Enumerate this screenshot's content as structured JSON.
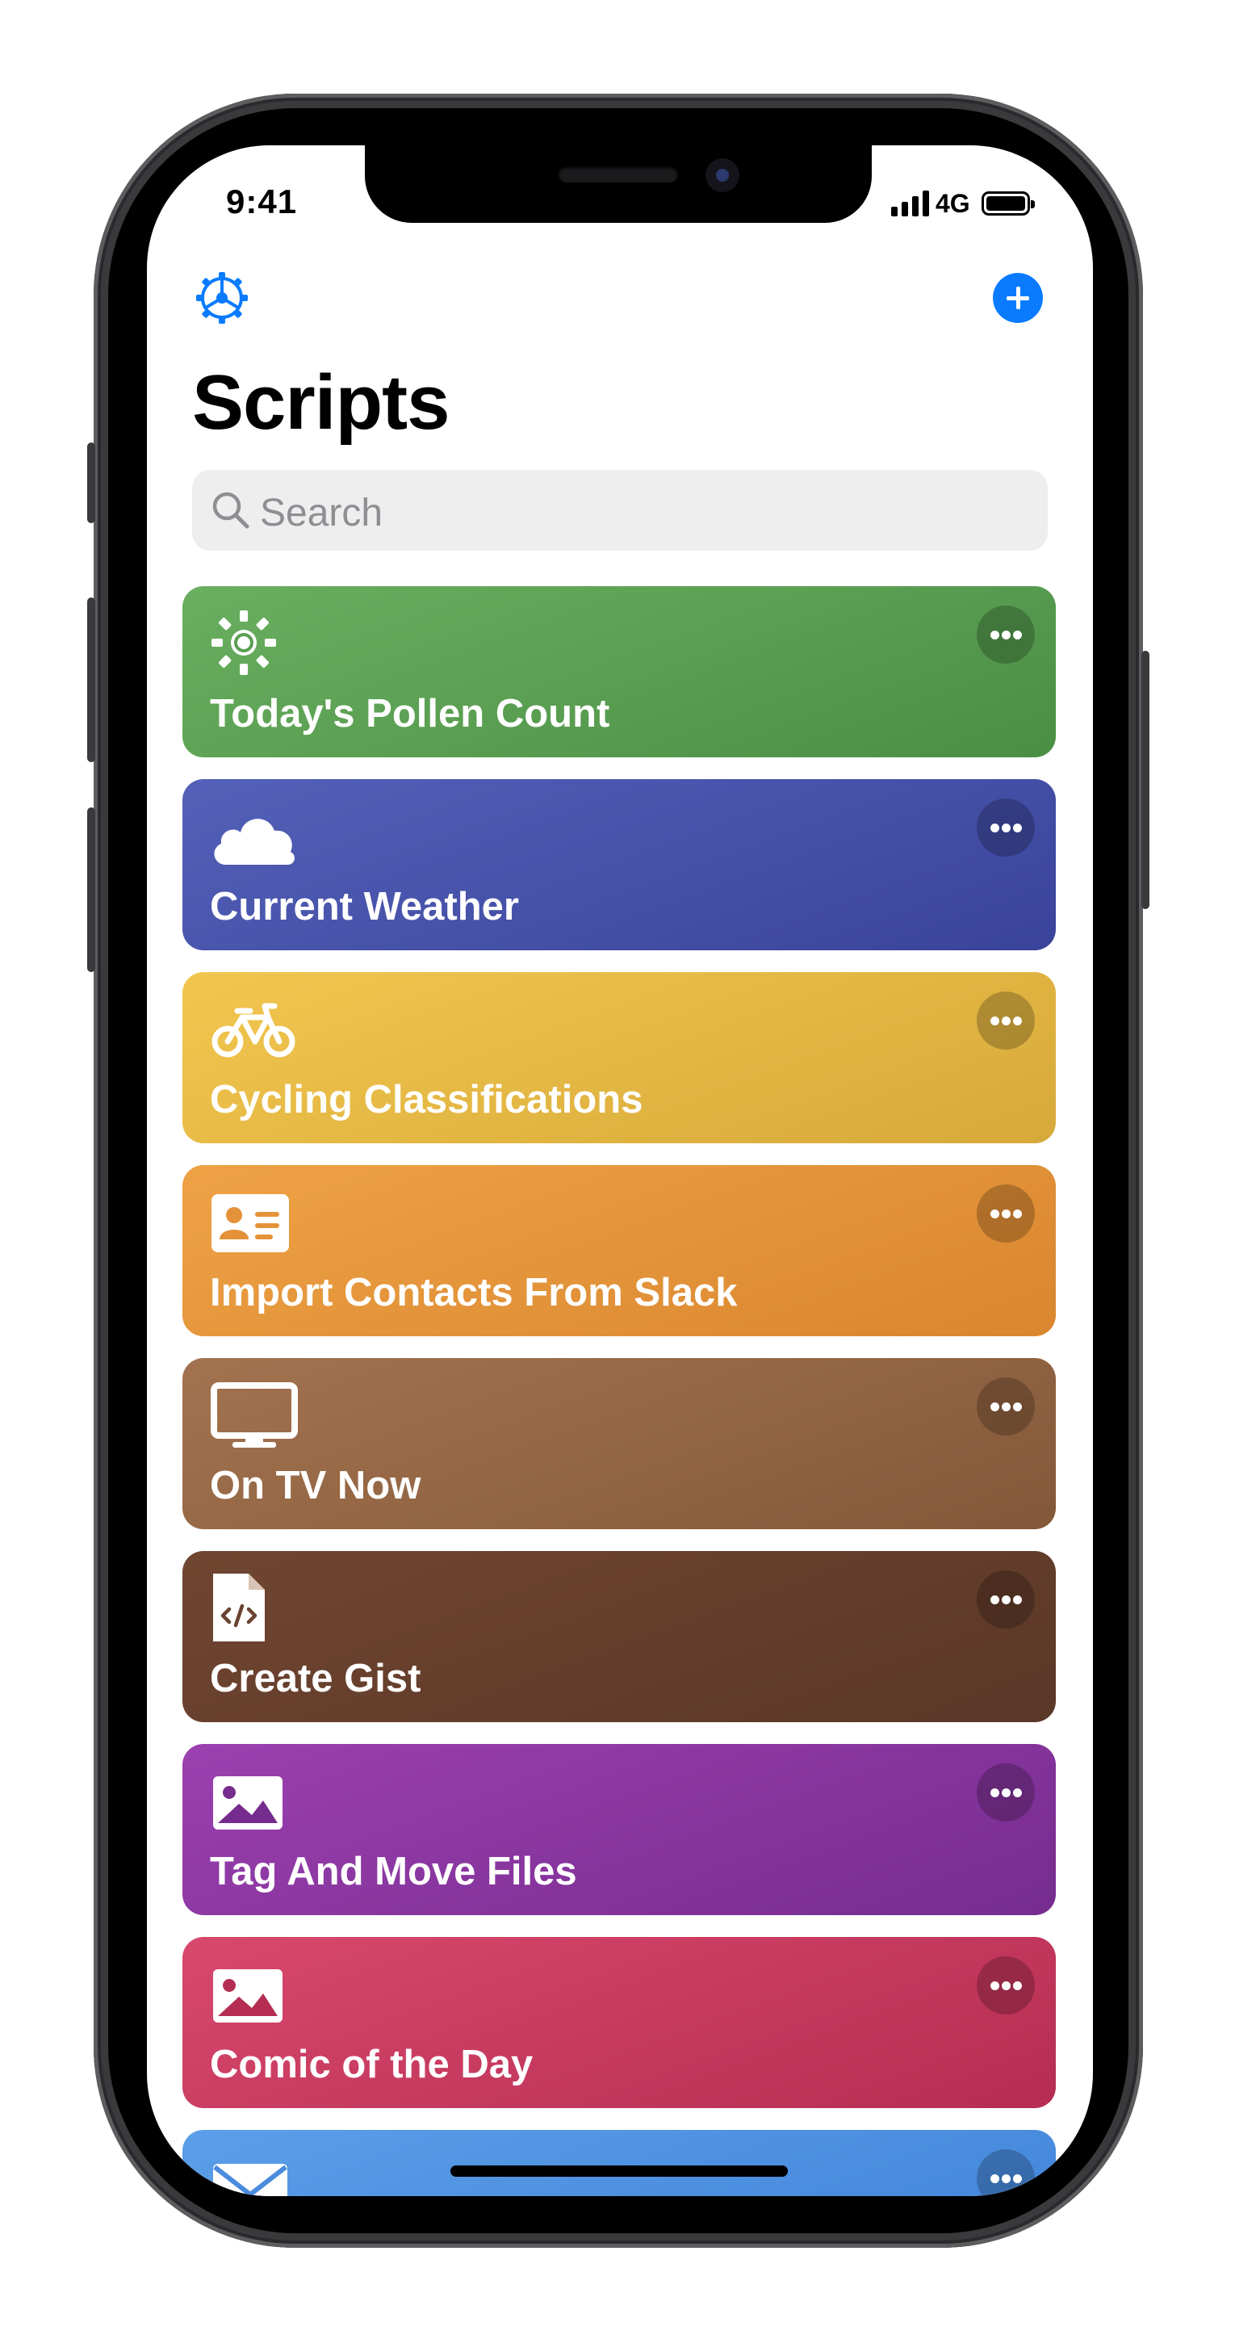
{
  "status_bar": {
    "time": "9:41",
    "network": "4G"
  },
  "header": {
    "title": "Scripts",
    "settings_icon": "gear-icon",
    "add_icon": "plus-icon"
  },
  "search": {
    "placeholder": "Search"
  },
  "colors": {
    "accent": "#0a7bff"
  },
  "scripts": [
    {
      "label": "Today's Pollen Count",
      "icon": "sun-icon",
      "colors": [
        "#6aaf60",
        "#4a8e44"
      ]
    },
    {
      "label": "Current Weather",
      "icon": "cloud-icon",
      "colors": [
        "#5461b8",
        "#39439a"
      ]
    },
    {
      "label": "Cycling Classifications",
      "icon": "bicycle-icon",
      "colors": [
        "#f2c64e",
        "#d6a93a"
      ]
    },
    {
      "label": "Import Contacts From Slack",
      "icon": "contact-card-icon",
      "colors": [
        "#eea245",
        "#d9862f"
      ]
    },
    {
      "label": "On TV Now",
      "icon": "tv-icon",
      "colors": [
        "#a37350",
        "#835838"
      ]
    },
    {
      "label": "Create Gist",
      "icon": "code-file-icon",
      "colors": [
        "#704631",
        "#5a3727"
      ]
    },
    {
      "label": "Tag And Move Files",
      "icon": "image-icon",
      "colors": [
        "#9b40b0",
        "#762c8e"
      ]
    },
    {
      "label": "Comic of the Day",
      "icon": "image-icon",
      "colors": [
        "#d8486c",
        "#b52d53"
      ]
    },
    {
      "label": "",
      "icon": "envelope-icon",
      "colors": [
        "#5b9ee8",
        "#3f82d8"
      ]
    }
  ]
}
